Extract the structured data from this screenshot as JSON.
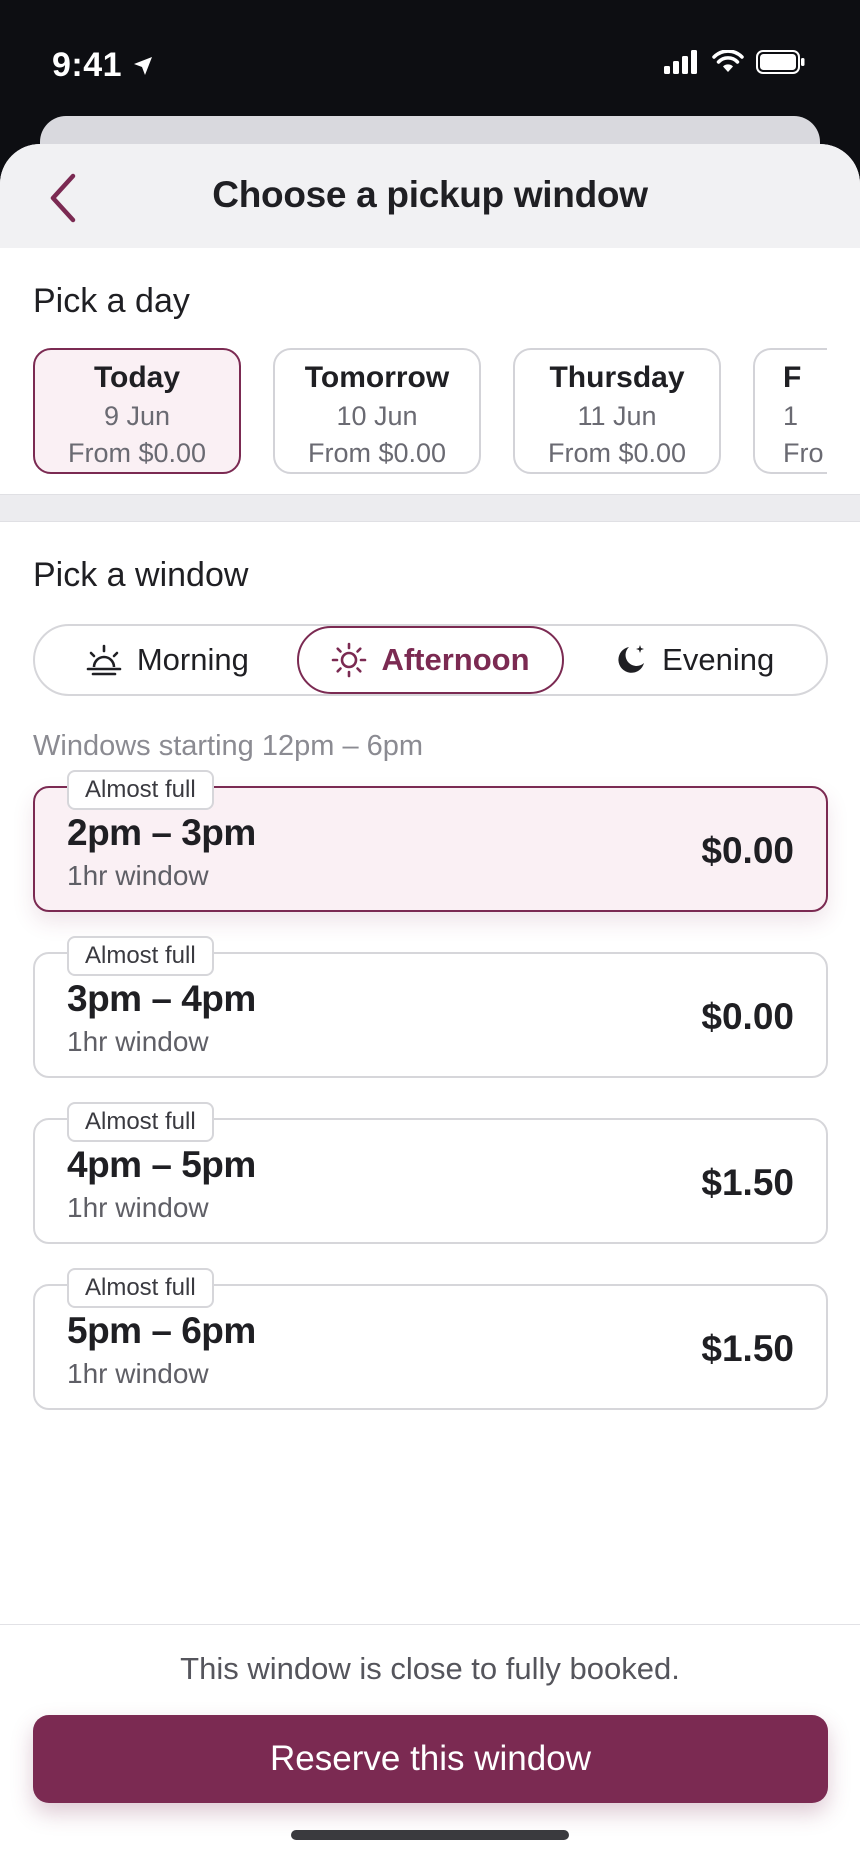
{
  "status_bar": {
    "time": "9:41"
  },
  "header": {
    "title": "Choose a pickup window"
  },
  "day_section": {
    "title": "Pick a day",
    "days": [
      {
        "name": "Today",
        "date": "9 Jun",
        "price": "From $0.00",
        "selected": true
      },
      {
        "name": "Tomorrow",
        "date": "10 Jun",
        "price": "From $0.00",
        "selected": false
      },
      {
        "name": "Thursday",
        "date": "11 Jun",
        "price": "From $0.00",
        "selected": false
      },
      {
        "name": "F",
        "date": "1",
        "price": "Fro",
        "selected": false
      }
    ]
  },
  "window_section": {
    "title": "Pick a window",
    "segments": [
      {
        "label": "Morning",
        "icon": "sunrise-icon",
        "active": false
      },
      {
        "label": "Afternoon",
        "icon": "sun-icon",
        "active": true
      },
      {
        "label": "Evening",
        "icon": "moon-icon",
        "active": false
      }
    ],
    "hint": "Windows starting 12pm – 6pm",
    "slots": [
      {
        "badge": "Almost full",
        "time": "2pm – 3pm",
        "duration": "1hr window",
        "price": "$0.00",
        "selected": true
      },
      {
        "badge": "Almost full",
        "time": "3pm – 4pm",
        "duration": "1hr window",
        "price": "$0.00",
        "selected": false
      },
      {
        "badge": "Almost full",
        "time": "4pm – 5pm",
        "duration": "1hr window",
        "price": "$1.50",
        "selected": false
      },
      {
        "badge": "Almost full",
        "time": "5pm – 6pm",
        "duration": "1hr window",
        "price": "$1.50",
        "selected": false
      }
    ]
  },
  "footer": {
    "note": "This window is close to fully booked.",
    "button_label": "Reserve this window"
  },
  "colors": {
    "accent": "#7b2a52",
    "accent_tint": "#faf0f4"
  }
}
